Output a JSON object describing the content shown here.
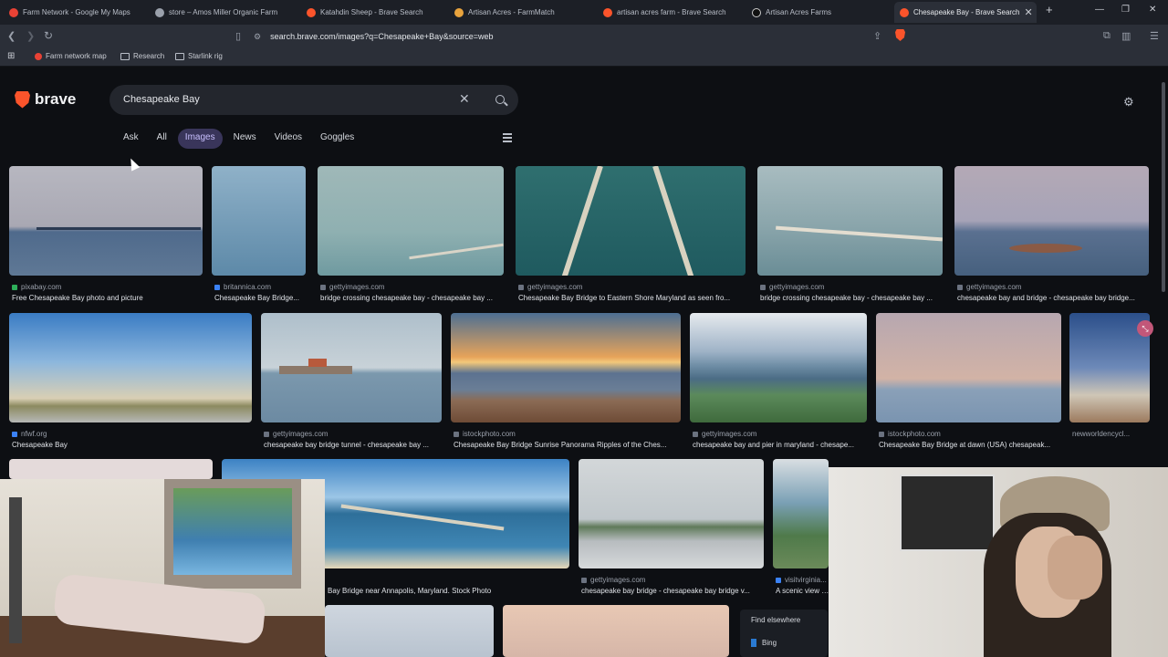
{
  "browser": {
    "tabs": [
      {
        "title": "Farm Network - Google My Maps",
        "color": "#e94235"
      },
      {
        "title": "store – Amos Miller Organic Farm",
        "color": "#9aa0ab"
      },
      {
        "title": "Katahdin Sheep - Brave Search",
        "color": "#fb542b"
      },
      {
        "title": "Artisan Acres - FarmMatch",
        "color": "#e8a33d"
      },
      {
        "title": "artisan acres farm - Brave Search",
        "color": "#fb542b"
      },
      {
        "title": "Artisan Acres Farms",
        "color": "#111111"
      },
      {
        "title": "Chesapeake Bay - Brave Search",
        "color": "#fb542b"
      }
    ],
    "new_tab": "+",
    "url": "search.brave.com/images?q=Chesapeake+Bay&source=web",
    "bookmarks": [
      {
        "label": "Farm network map"
      },
      {
        "label": "Research"
      },
      {
        "label": "Starlink rig"
      }
    ]
  },
  "search": {
    "logo_text": "brave",
    "query": "Chesapeake Bay",
    "tabs": [
      "Ask",
      "All",
      "Images",
      "News",
      "Videos",
      "Goggles"
    ],
    "active_tab": "Images"
  },
  "results": [
    {
      "source": "pixabay.com",
      "caption": "Free Chesapeake Bay photo and picture"
    },
    {
      "source": "britannica.com",
      "caption": "Chesapeake Bay Bridge..."
    },
    {
      "source": "gettyimages.com",
      "caption": "bridge crossing chesapeake bay - chesapeake bay ..."
    },
    {
      "source": "gettyimages.com",
      "caption": "Chesapeake Bay Bridge to Eastern Shore Maryland as seen fro..."
    },
    {
      "source": "gettyimages.com",
      "caption": "bridge crossing chesapeake bay - chesapeake bay ..."
    },
    {
      "source": "gettyimages.com",
      "caption": "chesapeake bay and bridge - chesapeake bay bridge..."
    },
    {
      "source": "nfwf.org",
      "caption": "Chesapeake Bay"
    },
    {
      "source": "gettyimages.com",
      "caption": "chesapeake bay bridge tunnel - chesapeake bay ..."
    },
    {
      "source": "istockphoto.com",
      "caption": "Chesapeake Bay Bridge Sunrise Panorama Ripples of the Ches..."
    },
    {
      "source": "gettyimages.com",
      "caption": "chesapeake bay and pier in maryland - chesape..."
    },
    {
      "source": "istockphoto.com",
      "caption": "Chesapeake Bay Bridge at dawn (USA) chesapeak..."
    },
    {
      "source": "newworldencycl...",
      "caption": ""
    },
    {
      "source": "",
      "caption": "Bay Bridge near Annapolis, Maryland. Stock Photo"
    },
    {
      "source": "gettyimages.com",
      "caption": "chesapeake bay bridge - chesapeake bay bridge v..."
    },
    {
      "source": "visitvirginia...",
      "caption": "A scenic view o..."
    }
  ],
  "find_elsewhere": {
    "title": "Find elsewhere",
    "engine": "Bing"
  },
  "colors": {
    "accent": "#fb542b",
    "active_tab_bg": "#39355a"
  }
}
